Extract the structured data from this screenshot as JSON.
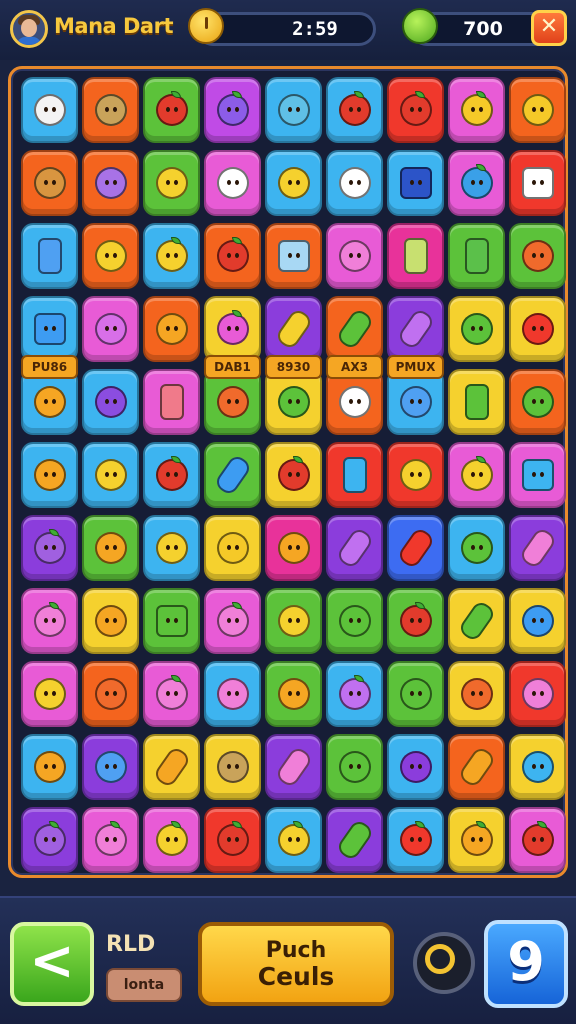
{
  "header": {
    "player_name": "Mana Dart",
    "timer": "2:59",
    "score": "700",
    "close_label": "✕"
  },
  "board": {
    "labels": [
      "PU86",
      "DAB1",
      "8930",
      "AX3",
      "PMUX"
    ],
    "rows": [
      [
        {
          "c": "#3db4f0",
          "o": "cat",
          "f": "#f4f4f4"
        },
        {
          "c": "#f4641e",
          "o": "palm",
          "f": "#c9a35a"
        },
        {
          "c": "#5cc23a",
          "o": "apple",
          "f": "#e23b2c"
        },
        {
          "c": "#c04be6",
          "o": "apple",
          "f": "#8c5ce8"
        },
        {
          "c": "#3db4f0",
          "o": "bird",
          "f": "#5fc0e6"
        },
        {
          "c": "#3db4f0",
          "o": "apple",
          "f": "#e23b2c"
        },
        {
          "c": "#f0382c",
          "o": "apple",
          "f": "#e23b2c"
        },
        {
          "c": "#e85bd6",
          "o": "lemon",
          "f": "#f5c928"
        },
        {
          "c": "#f4641e",
          "o": "sun",
          "f": "#f5c928"
        }
      ],
      [
        {
          "c": "#f4641e",
          "o": "bow",
          "f": "#d89540"
        },
        {
          "c": "#f4641e",
          "o": "robot",
          "f": "#a872e6"
        },
        {
          "c": "#5cc23a",
          "o": "banana",
          "f": "#f5d12e"
        },
        {
          "c": "#e85bd6",
          "o": "cloud",
          "f": "#ffffff"
        },
        {
          "c": "#3db4f0",
          "o": "cat",
          "f": "#f5d12e"
        },
        {
          "c": "#3db4f0",
          "o": "cat",
          "f": "#ffffff"
        },
        {
          "c": "#3db4f0",
          "o": "book",
          "f": "#2c54c8"
        },
        {
          "c": "#e85bd6",
          "o": "berry",
          "f": "#3aa0e8"
        },
        {
          "c": "#f0382c",
          "o": "camera",
          "f": "#ffffff"
        }
      ],
      [
        {
          "c": "#3db4f0",
          "o": "phone",
          "f": "#4fa0f2"
        },
        {
          "c": "#f4641e",
          "o": "face",
          "f": "#f5d12e"
        },
        {
          "c": "#3db4f0",
          "o": "lemon",
          "f": "#f5d12e"
        },
        {
          "c": "#f4641e",
          "o": "apple",
          "f": "#e23b2c"
        },
        {
          "c": "#f4641e",
          "o": "tablet",
          "f": "#a8d8f4"
        },
        {
          "c": "#e85bd6",
          "o": "face",
          "f": "#f07fd8"
        },
        {
          "c": "#e8329a",
          "o": "phone",
          "f": "#c8e070"
        },
        {
          "c": "#5cc23a",
          "o": "phone",
          "f": "#5bc04a"
        },
        {
          "c": "#5cc23a",
          "o": "face",
          "f": "#f06a2c"
        }
      ],
      [
        {
          "c": "#3db4f0",
          "o": "square",
          "f": "#3d9cf2"
        },
        {
          "c": "#e85bd6",
          "o": "monster",
          "f": "#d86fe8"
        },
        {
          "c": "#f4641e",
          "o": "face",
          "f": "#f5a623"
        },
        {
          "c": "#f5d12e",
          "o": "apple",
          "f": "#e85bd6"
        },
        {
          "c": "#8b3ddc",
          "o": "pop",
          "f": "#f5d12e"
        },
        {
          "c": "#f4641e",
          "o": "pop",
          "f": "#5cc23a"
        },
        {
          "c": "#8b3ddc",
          "o": "pop",
          "f": "#c070f0"
        },
        {
          "c": "#f5d12e",
          "o": "face",
          "f": "#5cc23a"
        },
        {
          "c": "#f5d12e",
          "o": "face",
          "f": "#f0382c"
        }
      ],
      [
        {
          "c": "#3db4f0",
          "o": "melon",
          "f": "#f5a623"
        },
        {
          "c": "#3db4f0",
          "o": "robot",
          "f": "#8b4de0"
        },
        {
          "c": "#e85bd6",
          "o": "phone",
          "f": "#f07a8a"
        },
        {
          "c": "#5cc23a",
          "o": "face",
          "f": "#f06a2c"
        },
        {
          "c": "#f5d12e",
          "o": "robot",
          "f": "#5cc23a"
        },
        {
          "c": "#f4641e",
          "o": "letter",
          "f": "#ffffff"
        },
        {
          "c": "#3db4f0",
          "o": "face",
          "f": "#4fa0f2"
        },
        {
          "c": "#f5d12e",
          "o": "phone",
          "f": "#5cc23a"
        },
        {
          "c": "#f4641e",
          "o": "plant",
          "f": "#5cc23a"
        }
      ],
      [
        {
          "c": "#3db4f0",
          "o": "face",
          "f": "#f5a623"
        },
        {
          "c": "#3db4f0",
          "o": "face",
          "f": "#f5d12e"
        },
        {
          "c": "#3db4f0",
          "o": "apple",
          "f": "#e23b2c"
        },
        {
          "c": "#5cc23a",
          "o": "carrot",
          "f": "#3d9cf2"
        },
        {
          "c": "#f5d12e",
          "o": "berry",
          "f": "#e23b2c"
        },
        {
          "c": "#f0382c",
          "o": "phone",
          "f": "#3db4f0"
        },
        {
          "c": "#f0382c",
          "o": "sun",
          "f": "#f5d12e"
        },
        {
          "c": "#e85bd6",
          "o": "lemon",
          "f": "#f5d12e"
        },
        {
          "c": "#e85bd6",
          "o": "camera",
          "f": "#3db4f0"
        }
      ],
      [
        {
          "c": "#8b3ddc",
          "o": "berry",
          "f": "#a060e0"
        },
        {
          "c": "#5cc23a",
          "o": "face",
          "f": "#f5a623"
        },
        {
          "c": "#3db4f0",
          "o": "face",
          "f": "#f5d12e"
        },
        {
          "c": "#f5d12e",
          "o": "banana",
          "f": "#f5c928"
        },
        {
          "c": "#e8329a",
          "o": "bow",
          "f": "#f5a623"
        },
        {
          "c": "#8b3ddc",
          "o": "pop",
          "f": "#c070f0"
        },
        {
          "c": "#3d6cf2",
          "o": "pop",
          "f": "#f0382c"
        },
        {
          "c": "#3db4f0",
          "o": "face",
          "f": "#5cc23a"
        },
        {
          "c": "#8b3ddc",
          "o": "pop",
          "f": "#f07fd8"
        }
      ],
      [
        {
          "c": "#e85bd6",
          "o": "apple",
          "f": "#f07fd8"
        },
        {
          "c": "#f5d12e",
          "o": "face",
          "f": "#f5a623"
        },
        {
          "c": "#5cc23a",
          "o": "square",
          "f": "#5cc23a"
        },
        {
          "c": "#e85bd6",
          "o": "apple",
          "f": "#f07fd8"
        },
        {
          "c": "#5cc23a",
          "o": "face",
          "f": "#f5d12e"
        },
        {
          "c": "#5cc23a",
          "o": "face",
          "f": "#5cc23a"
        },
        {
          "c": "#5cc23a",
          "o": "apple",
          "f": "#e23b2c"
        },
        {
          "c": "#f5d12e",
          "o": "carrot",
          "f": "#5cc23a"
        },
        {
          "c": "#f5d12e",
          "o": "face",
          "f": "#3d9cf2"
        }
      ],
      [
        {
          "c": "#e85bd6",
          "o": "melon",
          "f": "#f5d12e"
        },
        {
          "c": "#f4641e",
          "o": "face",
          "f": "#f06a2c"
        },
        {
          "c": "#e85bd6",
          "o": "apple",
          "f": "#f07fd8"
        },
        {
          "c": "#3db4f0",
          "o": "cat",
          "f": "#f07fd8"
        },
        {
          "c": "#5cc23a",
          "o": "melon",
          "f": "#f5a623"
        },
        {
          "c": "#3db4f0",
          "o": "apple",
          "f": "#c070f0"
        },
        {
          "c": "#5cc23a",
          "o": "face",
          "f": "#5cc23a"
        },
        {
          "c": "#f5d12e",
          "o": "face",
          "f": "#f06a2c"
        },
        {
          "c": "#f0382c",
          "o": "face",
          "f": "#f07fd8"
        }
      ],
      [
        {
          "c": "#3db4f0",
          "o": "sun",
          "f": "#f5a623"
        },
        {
          "c": "#8b3ddc",
          "o": "crystal",
          "f": "#4fa0f2"
        },
        {
          "c": "#f5d12e",
          "o": "carrot",
          "f": "#f5a623"
        },
        {
          "c": "#f5d12e",
          "o": "robot",
          "f": "#c9a35a"
        },
        {
          "c": "#8b3ddc",
          "o": "pop",
          "f": "#f07fd8"
        },
        {
          "c": "#5cc23a",
          "o": "face",
          "f": "#5cc23a"
        },
        {
          "c": "#3db4f0",
          "o": "crystal",
          "f": "#8b3ddc"
        },
        {
          "c": "#f4641e",
          "o": "carrot",
          "f": "#f5a623"
        },
        {
          "c": "#f5d12e",
          "o": "cat",
          "f": "#3db4f0"
        }
      ],
      [
        {
          "c": "#8b3ddc",
          "o": "berry",
          "f": "#a060e0"
        },
        {
          "c": "#e85bd6",
          "o": "apple",
          "f": "#f07fd8"
        },
        {
          "c": "#e85bd6",
          "o": "lemon",
          "f": "#f5d12e"
        },
        {
          "c": "#f0382c",
          "o": "apple",
          "f": "#e23b2c"
        },
        {
          "c": "#3db4f0",
          "o": "lemon",
          "f": "#f5d12e"
        },
        {
          "c": "#8b3ddc",
          "o": "pop",
          "f": "#5cc23a"
        },
        {
          "c": "#3db4f0",
          "o": "apple",
          "f": "#f0382c"
        },
        {
          "c": "#f5d12e",
          "o": "apple",
          "f": "#f5a623"
        },
        {
          "c": "#e85bd6",
          "o": "apple",
          "f": "#e23b2c"
        }
      ]
    ]
  },
  "footer": {
    "back_label": "<",
    "rld_label": "RLD",
    "small_label": "lonta",
    "push_line1": "Puch",
    "push_line2": "Ceuls",
    "nine_label": "9"
  }
}
